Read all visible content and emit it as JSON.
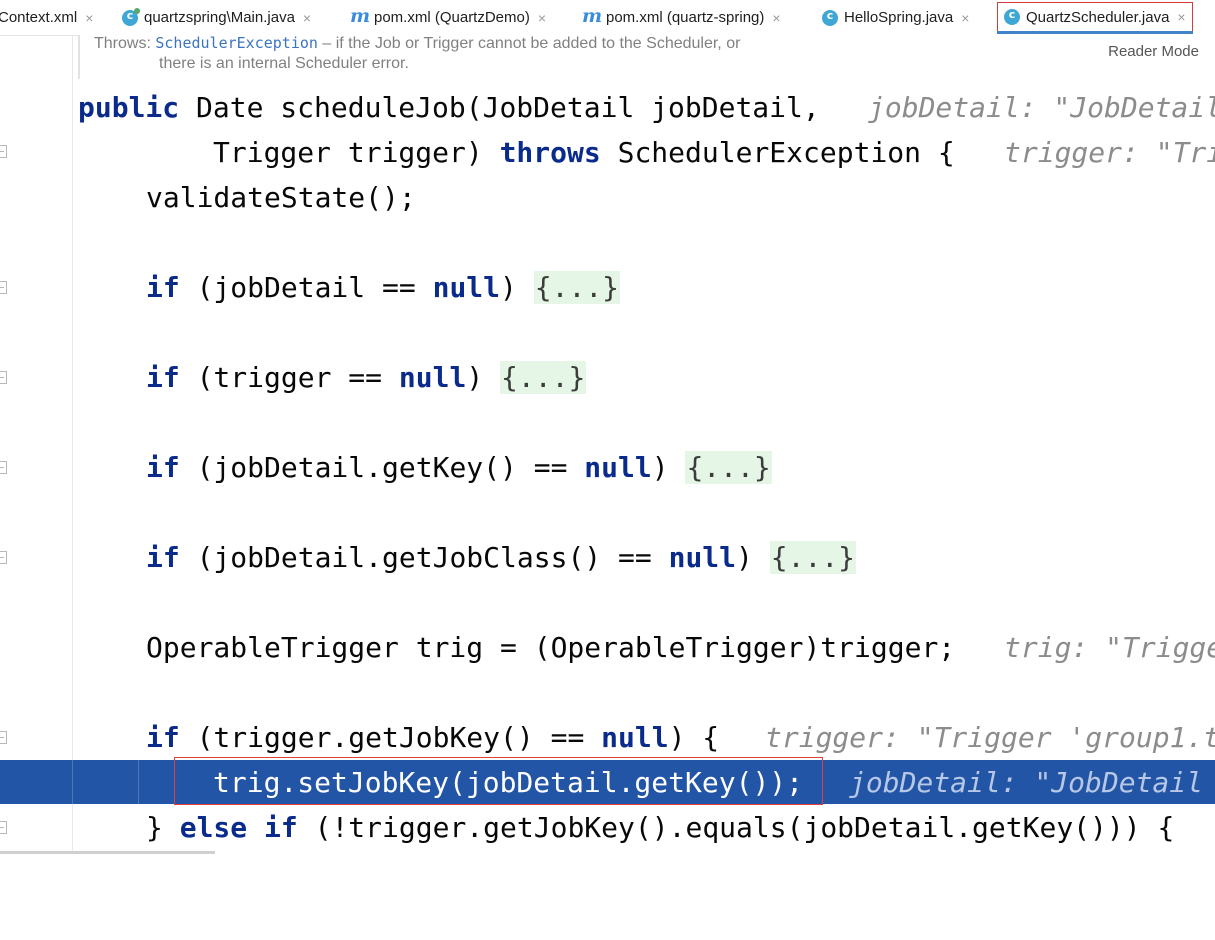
{
  "tabs": [
    {
      "label": "Context.xml",
      "icon": "xml-file-icon"
    },
    {
      "label": "quartzspring\\Main.java",
      "icon": "java-class-run-icon"
    },
    {
      "label": "pom.xml (QuartzDemo)",
      "icon": "maven-icon"
    },
    {
      "label": "pom.xml (quartz-spring)",
      "icon": "maven-icon"
    },
    {
      "label": "HelloSpring.java",
      "icon": "java-class-icon"
    },
    {
      "label": "QuartzScheduler.java",
      "icon": "java-class-icon",
      "active": true
    }
  ],
  "close_glyph": "×",
  "doc": {
    "throws_label": "Throws:",
    "exception": "SchedulerException",
    "desc1": " – if the Job or Trigger cannot be added to the Scheduler, or",
    "desc2": "there is an internal Scheduler error.",
    "reader_mode": "Reader Mode"
  },
  "code": {
    "l1_kw": "public",
    "l1_text": " Date scheduleJob(JobDetail jobDetail,",
    "l1_hint": "jobDetail: \"JobDetail",
    "l2_text": "Trigger trigger) ",
    "l2_kw": "throws",
    "l2_text2": " SchedulerException {",
    "l2_hint": "trigger: \"Tri",
    "l3_text": "validateState();",
    "if_kw": "if",
    "null_kw": "null",
    "fold_placeholder": "{...}",
    "l4_a": " (jobDetail == ",
    "l5_a": " (trigger == ",
    "l6_a": " (jobDetail.getKey() == ",
    "l7_a": " (jobDetail.getJobClass() == ",
    "close_paren": ") ",
    "l8_text": "OperableTrigger trig = (OperableTrigger)trigger;",
    "l8_hint": "trig: \"Trigge",
    "l9_a": " (trigger.getJobKey() == ",
    "l9_b": ") {",
    "l9_hint": "trigger: \"Trigger 'group1.t",
    "l10_text": "trig.setJobKey(jobDetail.getKey());",
    "l10_hint": "jobDetail: \"JobDetail",
    "l11_a": "} ",
    "else_kw": "else",
    "l11_b": " (!trigger.getJobKey().equals(jobDetail.getKey())) {"
  }
}
